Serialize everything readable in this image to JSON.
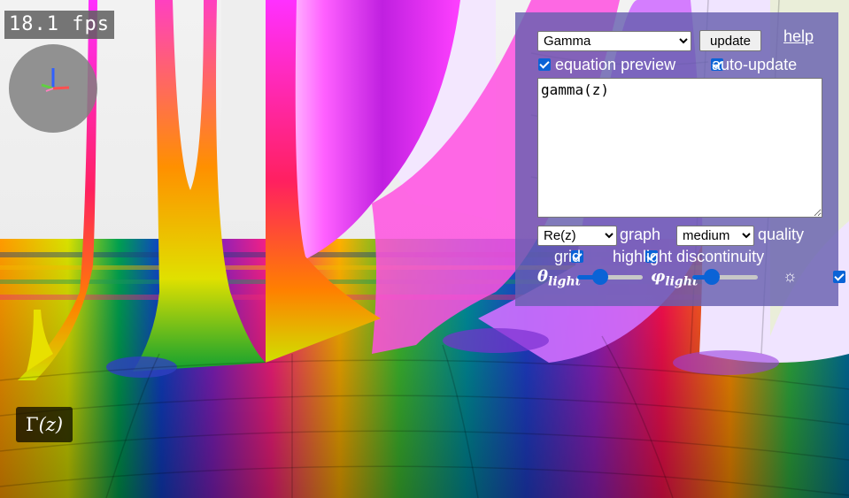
{
  "fps": {
    "text": "18.1 fps"
  },
  "function_label": {
    "symbol": "Γ",
    "arg": "(z)"
  },
  "panel": {
    "function_select": {
      "selected": "Gamma"
    },
    "update_button": "update",
    "help_link": "help",
    "equation_preview": {
      "label": "equation preview",
      "checked": true
    },
    "auto_update": {
      "label": "auto-update",
      "checked": true
    },
    "equation_text": "gamma(z)",
    "graph_mode": {
      "selected": "Re(z)",
      "label": "graph"
    },
    "quality": {
      "selected": "medium",
      "label": "quality"
    },
    "grid": {
      "label": "grid",
      "checked": true
    },
    "highlight_discontinuity": {
      "label": "highlight discontinuity",
      "checked": true
    },
    "theta_light": {
      "symbol": "θ",
      "sub": "light",
      "value_fraction": 0.35
    },
    "phi_light": {
      "symbol": "φ",
      "sub": "light",
      "value_fraction": 0.3
    },
    "light_toggle": {
      "checked": true,
      "icon": "sun-icon",
      "glyph": "☼"
    }
  },
  "colors": {
    "panel_bg": "#6860b0",
    "accent": "#0a63d6"
  }
}
